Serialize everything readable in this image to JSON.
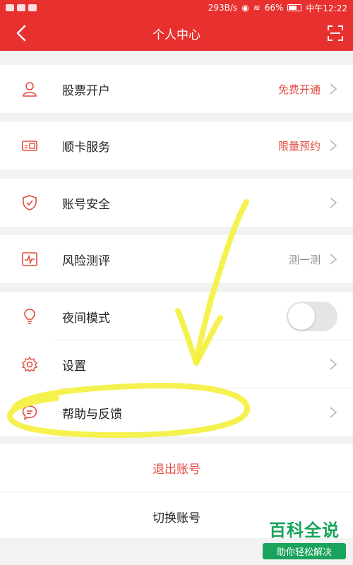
{
  "status_bar": {
    "speed": "293B/s",
    "battery": "66%",
    "time": "中午12:22"
  },
  "header": {
    "title": "个人中心"
  },
  "menu": {
    "stock_account": {
      "label": "股票开户",
      "value": "免费开通"
    },
    "card_service": {
      "label": "顺卡服务",
      "value": "限量预约"
    },
    "account_security": {
      "label": "账号安全"
    },
    "risk_assessment": {
      "label": "风险测评",
      "value": "测一测"
    },
    "night_mode": {
      "label": "夜间模式"
    },
    "settings": {
      "label": "设置"
    },
    "help_feedback": {
      "label": "帮助与反馈"
    }
  },
  "actions": {
    "logout": "退出账号",
    "switch_account": "切换账号"
  },
  "watermark": {
    "main": "百科全说",
    "sub": "助你轻松解决"
  },
  "colors": {
    "brand_red": "#e8312f",
    "value_red": "#e24c3f",
    "highlight_yellow": "#f4f03c",
    "watermark_green": "#1aa35a"
  }
}
